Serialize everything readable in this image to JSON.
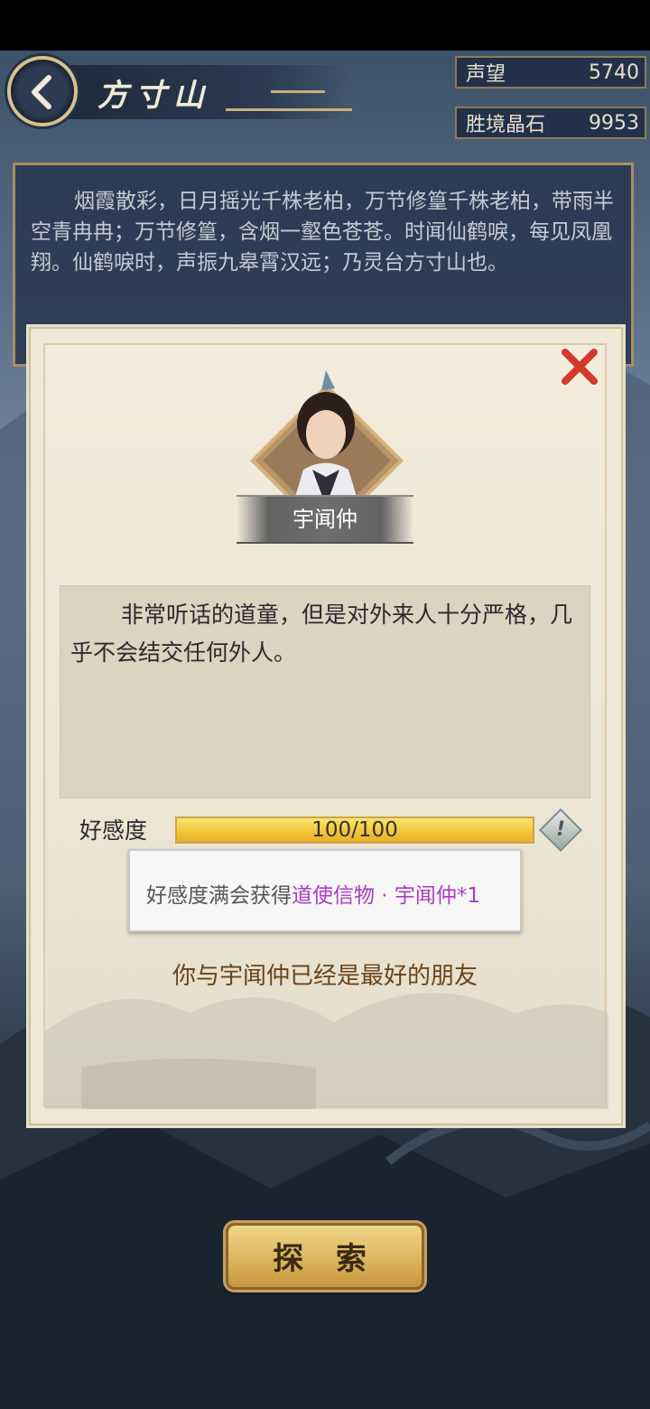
{
  "header": {
    "title": "方寸山",
    "back_icon": "chevron-left-icon"
  },
  "resources": [
    {
      "label": "声望",
      "value": "5740"
    },
    {
      "label": "胜境晶石",
      "value": "9953"
    }
  ],
  "location_description": "烟霞散彩，日月摇光千株老柏，万节修篁千株老柏，带雨半空青冉冉；万节修篁，含烟一壑色苍苍。时闻仙鹤唳，每见凤凰翔。仙鹤唳时，声振九皋霄汉远；乃灵台方寸山也。",
  "npc_dialog": {
    "name": "宇闻仲",
    "bio": "非常听话的道童，但是对外来人十分严格，几乎不会结交任何外人。",
    "favor_label": "好感度",
    "favor_value_text": "100/100",
    "favor_fraction": 1.0,
    "info_icon": "!",
    "tooltip_prefix": "好感度满会获得",
    "tooltip_reward": "道使信物 · 宇闻仲*1",
    "friend_status": "你与宇闻仲已经是最好的朋友",
    "close_icon": "close-icon"
  },
  "explore_button": "探 索",
  "colors": {
    "reward_highlight": "#a63fc0",
    "favor_bar": "#f1c437",
    "close_red": "#d23a2a"
  }
}
